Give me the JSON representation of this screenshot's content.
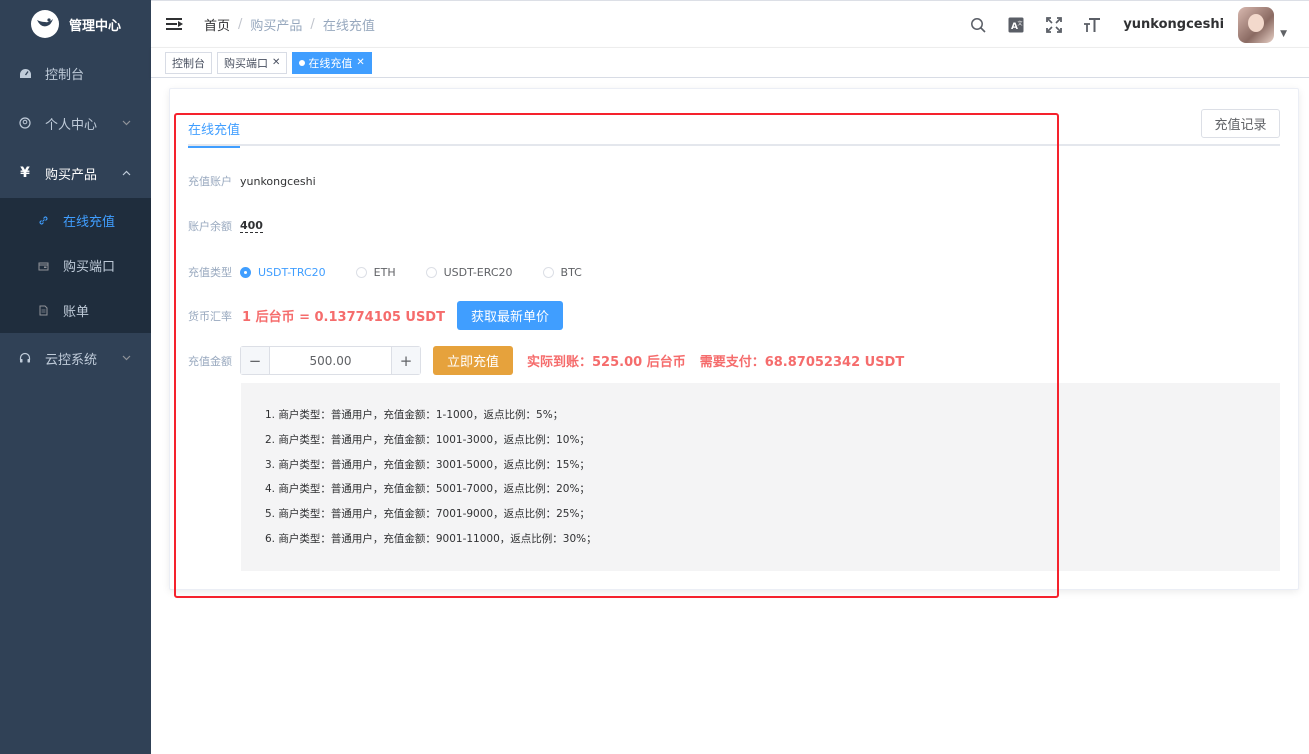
{
  "app": {
    "title": "管理中心"
  },
  "sidebar": {
    "items": [
      {
        "label": "控制台",
        "icon": "dashboard-icon"
      },
      {
        "label": "个人中心",
        "icon": "user-icon",
        "chevron": "down"
      },
      {
        "label": "购买产品",
        "icon": "yen-icon",
        "chevron": "up",
        "children": [
          {
            "label": "在线充值",
            "icon": "link-icon",
            "active": true
          },
          {
            "label": "购买端口",
            "icon": "wallet-icon"
          },
          {
            "label": "账单",
            "icon": "document-icon"
          }
        ]
      },
      {
        "label": "云控系统",
        "icon": "headset-icon",
        "chevron": "down"
      }
    ]
  },
  "header": {
    "breadcrumb": [
      "首页",
      "购买产品",
      "在线充值"
    ],
    "username": "yunkongceshi"
  },
  "tags": [
    {
      "label": "控制台"
    },
    {
      "label": "购买端口",
      "closable": true
    },
    {
      "label": "在线充值",
      "closable": true,
      "active": true
    }
  ],
  "card": {
    "tab": "在线充值",
    "record_button": "充值记录",
    "account_label": "充值账户",
    "account_value": "yunkongceshi",
    "balance_label": "账户余额",
    "balance_value": "400",
    "type_label": "充值类型",
    "types": [
      "USDT-TRC20",
      "ETH",
      "USDT-ERC20",
      "BTC"
    ],
    "selected_type": "USDT-TRC20",
    "rate_label": "货币汇率",
    "rate_text": "1 后台币 = 0.13774105 USDT",
    "refresh_button": "获取最新单价",
    "amount_label": "充值金额",
    "amount_value": "500.00",
    "stepper_minus": "−",
    "stepper_plus": "+",
    "submit_button": "立即充值",
    "arrive_text": "实际到账：525.00 后台币",
    "pay_text": "需要支付：68.87052342 USDT",
    "tips": [
      "1. 商户类型：普通用户，充值金额：1-1000，返点比例：5%；",
      "2. 商户类型：普通用户，充值金额：1001-3000，返点比例：10%；",
      "3. 商户类型：普通用户，充值金额：3001-5000，返点比例：15%；",
      "4. 商户类型：普通用户，充值金额：5001-7000，返点比例：20%；",
      "5. 商户类型：普通用户，充值金额：7001-9000，返点比例：25%；",
      "6. 商户类型：普通用户，充值金额：9001-11000，返点比例：30%；"
    ]
  },
  "colors": {
    "sidebar_bg": "#304156",
    "primary": "#409eff",
    "warning": "#e6a23c",
    "danger": "#f56c6c",
    "highlight_outline": "#f5222d"
  }
}
